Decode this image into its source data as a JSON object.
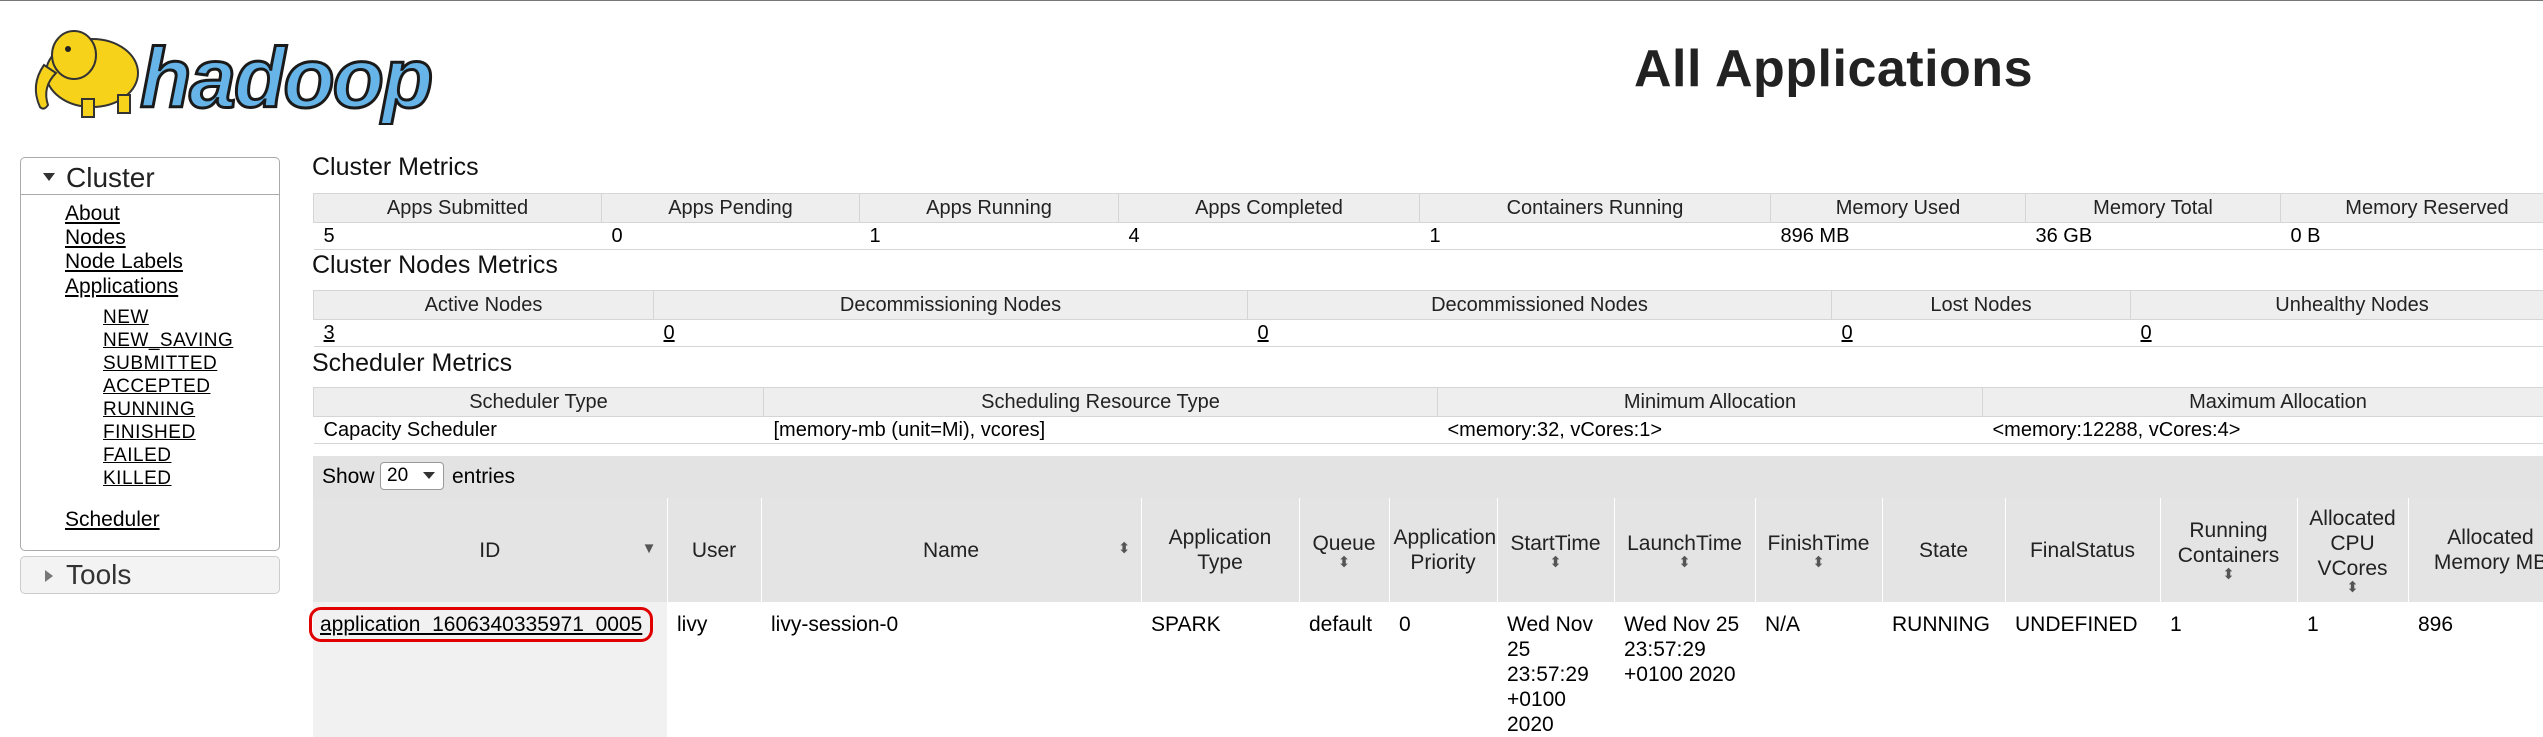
{
  "header": {
    "logo_text": "hadoop",
    "page_title": "All Applications"
  },
  "sidebar": {
    "cluster_label": "Cluster",
    "links": [
      "About",
      "Nodes",
      "Node Labels",
      "Applications"
    ],
    "app_states": [
      "NEW",
      "NEW_SAVING",
      "SUBMITTED",
      "ACCEPTED",
      "RUNNING",
      "FINISHED",
      "FAILED",
      "KILLED"
    ],
    "scheduler_label": "Scheduler",
    "tools_label": "Tools"
  },
  "cluster_metrics": {
    "title": "Cluster Metrics",
    "headers": [
      "Apps Submitted",
      "Apps Pending",
      "Apps Running",
      "Apps Completed",
      "Containers Running",
      "Memory Used",
      "Memory Total",
      "Memory Reserved"
    ],
    "values": [
      "5",
      "0",
      "1",
      "4",
      "1",
      "896 MB",
      "36 GB",
      "0 B"
    ]
  },
  "node_metrics": {
    "title": "Cluster Nodes Metrics",
    "headers": [
      "Active Nodes",
      "Decommissioning Nodes",
      "Decommissioned Nodes",
      "Lost Nodes",
      "Unhealthy Nodes"
    ],
    "values": [
      "3",
      "0",
      "0",
      "0",
      "0"
    ]
  },
  "scheduler_metrics": {
    "title": "Scheduler Metrics",
    "headers": [
      "Scheduler Type",
      "Scheduling Resource Type",
      "Minimum Allocation",
      "Maximum Allocation"
    ],
    "values": [
      "Capacity Scheduler",
      "[memory-mb (unit=Mi), vcores]",
      "<memory:32, vCores:1>",
      "<memory:12288, vCores:4>"
    ]
  },
  "entries": {
    "show_label": "Show",
    "page_size": "20",
    "entries_label": "entries"
  },
  "apps_table": {
    "columns": [
      "ID",
      "User",
      "Name",
      "Application Type",
      "Queue",
      "Application Priority",
      "StartTime",
      "LaunchTime",
      "FinishTime",
      "State",
      "FinalStatus",
      "Running Containers",
      "Allocated CPU VCores",
      "Allocated Memory MB"
    ],
    "rows": [
      {
        "id": "application_1606340335971_0005",
        "user": "livy",
        "name": "livy-session-0",
        "type": "SPARK",
        "queue": "default",
        "priority": "0",
        "start_time": "Wed Nov 25 23:57:29 +0100 2020",
        "launch_time": "Wed Nov 25 23:57:29 +0100 2020",
        "finish_time": "N/A",
        "state": "RUNNING",
        "final_status": "UNDEFINED",
        "running_containers": "1",
        "allocated_vcores": "1",
        "allocated_memory": "896"
      }
    ]
  },
  "colors": {
    "highlight": "#e00000",
    "header_bg": "#e4e4e4",
    "logo_yellow": "#f7d21b",
    "logo_blue": "#66b4e8"
  }
}
